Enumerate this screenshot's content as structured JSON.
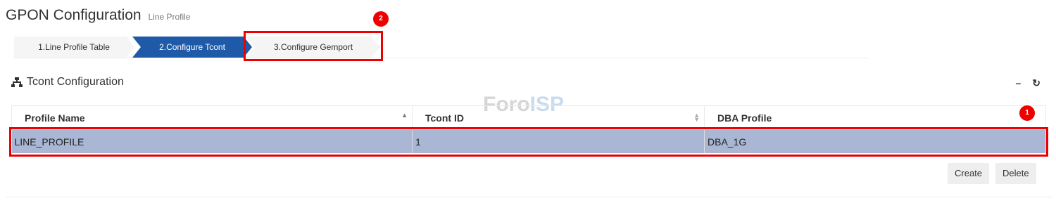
{
  "header": {
    "title": "GPON Configuration",
    "subtitle": "Line Profile"
  },
  "wizard": {
    "steps": [
      {
        "label": "1.Line Profile Table",
        "state": "done"
      },
      {
        "label": "2.Configure Tcont",
        "state": "active"
      },
      {
        "label": "3.Configure Gemport",
        "state": "next"
      }
    ]
  },
  "annotations": {
    "badge1": "1",
    "badge2": "2",
    "highlight_color": "#e00000"
  },
  "section": {
    "title": "Tcont Configuration",
    "icon": "sitemap-icon",
    "tools": [
      "minus-icon",
      "refresh-icon"
    ]
  },
  "watermark": {
    "part1": "Foro",
    "part2": "ISP"
  },
  "table": {
    "columns": [
      "Profile Name",
      "Tcont ID",
      "DBA Profile"
    ],
    "rows": [
      [
        "LINE_PROFILE",
        "1",
        "DBA_1G"
      ]
    ]
  },
  "buttons": {
    "create": "Create",
    "delete": "Delete"
  },
  "colors": {
    "active_step": "#1e5aa8",
    "selected_row": "#a9b7d4"
  }
}
